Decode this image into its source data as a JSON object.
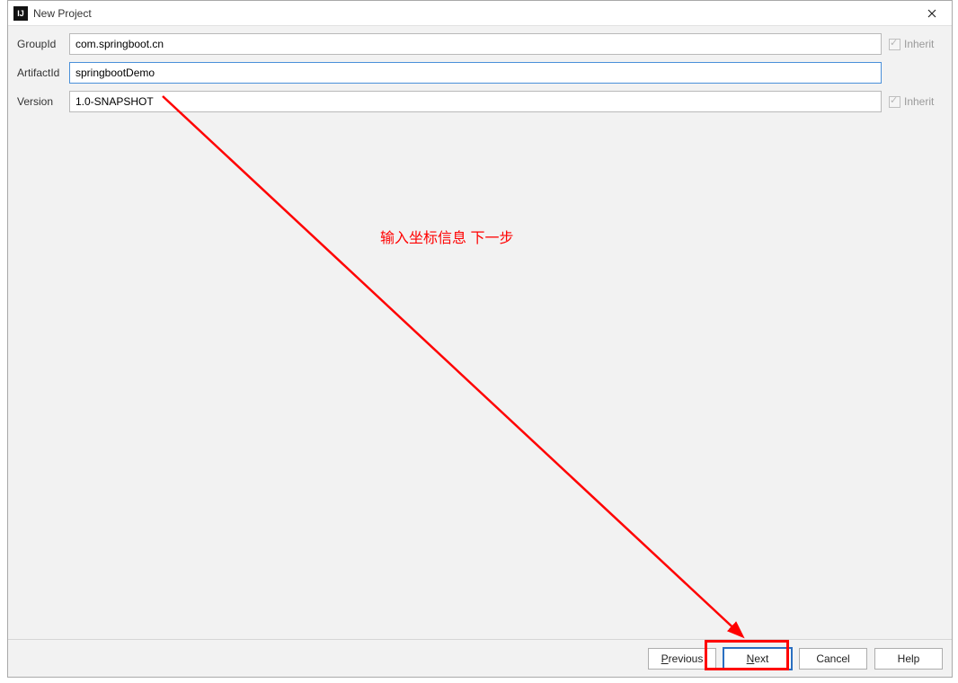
{
  "titlebar": {
    "title": "New Project",
    "app_icon_letter": "IJ"
  },
  "form": {
    "groupid_label": "GroupId",
    "groupid_value": "com.springboot.cn",
    "artifactid_label": "ArtifactId",
    "artifactid_value": "springbootDemo",
    "version_label": "Version",
    "version_value": "1.0-SNAPSHOT",
    "inherit_label": "Inherit"
  },
  "annotation": {
    "text": "输入坐标信息 下一步"
  },
  "buttons": {
    "previous": "Previous",
    "previous_mn": "P",
    "next": "Next",
    "next_mn": "N",
    "cancel": "Cancel",
    "help": "Help"
  }
}
